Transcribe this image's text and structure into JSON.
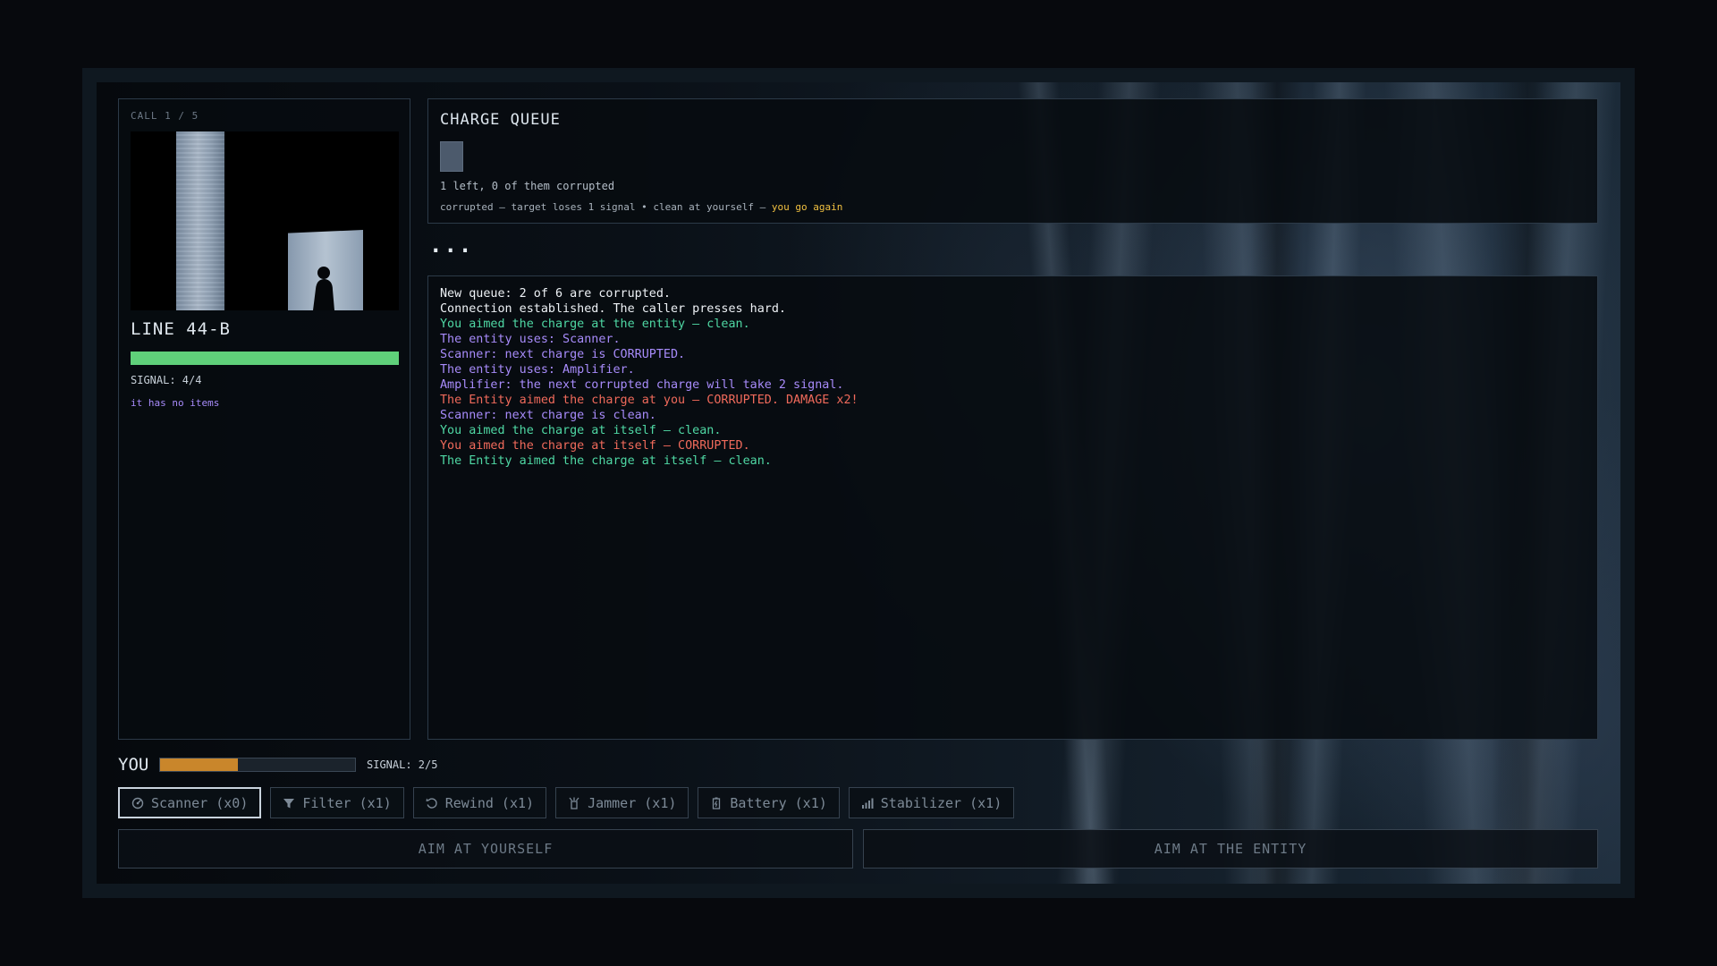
{
  "entity": {
    "call_counter": "CALL 1 / 5",
    "name": "LINE 44-B",
    "signal_label": "SIGNAL: 4/4",
    "signal_fraction": 1.0,
    "bar_color": "#5fd07a",
    "items_text": "it has no items"
  },
  "queue": {
    "title": "CHARGE QUEUE",
    "shells_remaining": 1,
    "status": "1 left, 0 of them corrupted",
    "legend_main": "corrupted – target loses 1 signal • clean at yourself – ",
    "legend_highlight": "you go again"
  },
  "thinking": "...",
  "log": [
    {
      "text": "New queue: 2 of 6 are corrupted.",
      "color": "white"
    },
    {
      "text": "Connection established. The caller presses hard.",
      "color": "white"
    },
    {
      "text": "You aimed the charge at the entity – clean.",
      "color": "green"
    },
    {
      "text": "The entity uses: Scanner.",
      "color": "purple"
    },
    {
      "text": "Scanner: next charge is CORRUPTED.",
      "color": "purple"
    },
    {
      "text": "The entity uses: Amplifier.",
      "color": "purple"
    },
    {
      "text": "Amplifier: the next corrupted charge will take 2 signal.",
      "color": "purple"
    },
    {
      "text": "The Entity aimed the charge at you – CORRUPTED. DAMAGE x2!",
      "color": "red"
    },
    {
      "text": "Scanner: next charge is clean.",
      "color": "purple"
    },
    {
      "text": "You aimed the charge at itself – clean.",
      "color": "green"
    },
    {
      "text": "You aimed the charge at itself – CORRUPTED.",
      "color": "red"
    },
    {
      "text": "The Entity aimed the charge at itself – clean.",
      "color": "green"
    }
  ],
  "player": {
    "label": "YOU",
    "signal_label": "SIGNAL: 2/5",
    "signal_fraction": 0.4,
    "bar_color": "#c9862b"
  },
  "items": [
    {
      "label": "Scanner (x0)",
      "icon": "scanner-icon",
      "selected": true
    },
    {
      "label": "Filter (x1)",
      "icon": "filter-icon",
      "selected": false
    },
    {
      "label": "Rewind (x1)",
      "icon": "rewind-icon",
      "selected": false
    },
    {
      "label": "Jammer (x1)",
      "icon": "jammer-icon",
      "selected": false
    },
    {
      "label": "Battery (x1)",
      "icon": "battery-icon",
      "selected": false
    },
    {
      "label": "Stabilizer (x1)",
      "icon": "stabilizer-icon",
      "selected": false
    }
  ],
  "actions": {
    "aim_self": "AIM AT YOURSELF",
    "aim_entity": "AIM AT THE ENTITY"
  }
}
